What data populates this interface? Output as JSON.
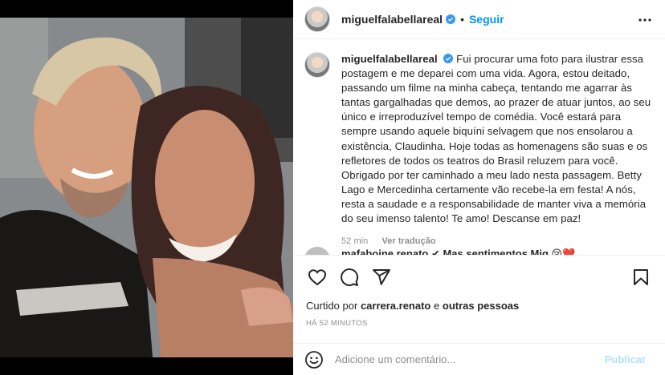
{
  "colors": {
    "accent": "#0095f6",
    "text": "#262626",
    "muted": "#8e8e8e",
    "publish_disabled": "#b2dffc",
    "photo_backdrop": "#000000"
  },
  "header": {
    "username": "miguelfalabellareal",
    "verified": true,
    "separator": "•",
    "follow_label": "Seguir",
    "more_icon": "more-horizontal-icon"
  },
  "caption": {
    "username": "miguelfalabellareal",
    "verified": true,
    "text": "Fui procurar uma foto para ilustrar essa postagem e me deparei com uma vida. Agora, estou deitado, passando um filme na minha cabeça, tentando me agarrar às tantas gargalhadas que demos, ao prazer de atuar juntos, ao seu único e irreproduzível tempo de comédia. Você estará para sempre usando aquele biquíni selvagem que nos ensolarou a existência, Claudinha. Hoje todas as homenagens são suas e os refletores de todos os teatros do Brasil reluzem para você. Obrigado por ter caminhado a meu lado nesta passagem. Betty Lago e Mercedinha certamente vão recebe-la em festa! A nós, resta a saudade e a responsabilidade de manter viva a memória do seu imenso talento! Te amo! Descanse em paz!",
    "age": "52 min",
    "translate_label": "Ver tradução"
  },
  "comment_peek": {
    "text": "mafaboine renato ✔ Mas sentimentos Mig 😢❤️"
  },
  "actions": {
    "like_icon": "heart-icon",
    "comment_icon": "comment-icon",
    "share_icon": "paper-plane-icon",
    "save_icon": "bookmark-icon"
  },
  "likes": {
    "prefix": "Curtido por",
    "user": "carrera.renato",
    "conjunction": "e",
    "others": "outras pessoas"
  },
  "timestamp": "HÁ 52 MINUTOS",
  "comment_bar": {
    "emoji_icon": "smiley-icon",
    "placeholder": "Adicione um comentário...",
    "publish_label": "Publicar"
  }
}
